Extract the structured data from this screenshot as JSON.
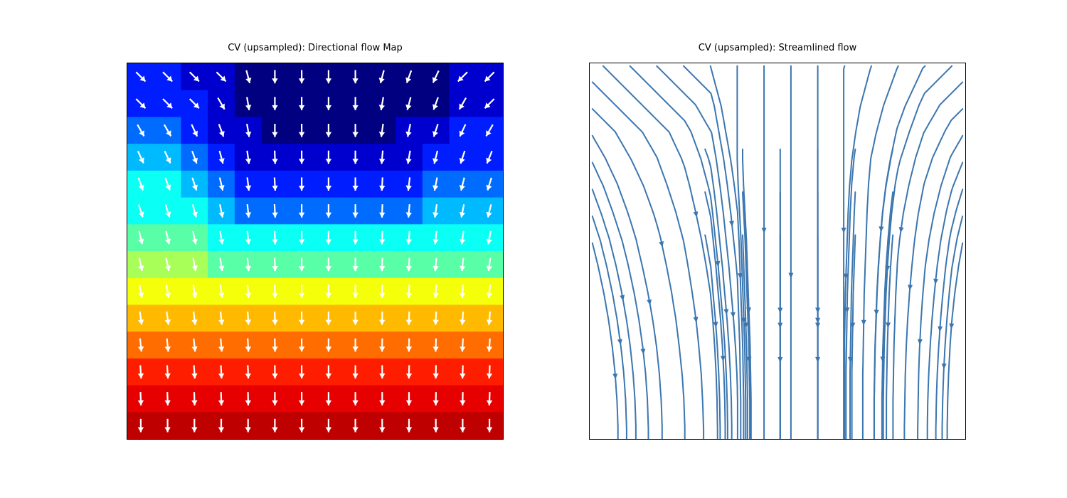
{
  "titles": {
    "left": "CV (upsampled): Directional flow Map",
    "right": "CV (upsampled): Streamlined flow"
  },
  "chart_data": [
    {
      "type": "heatmap",
      "name": "directional-flow",
      "title": "CV (upsampled): Directional flow Map",
      "grid": {
        "nx": 14,
        "ny": 14,
        "xlim": [
          0,
          14
        ],
        "ylim": [
          0,
          14
        ]
      },
      "colormap": "jet",
      "values_note": "Scalar field = row-index (0 top -> blue, 13 bottom -> red) with a dark-blue depression near columns 5-11 in rows 0-3. Arrows are unit vectors in white overlaid on each cell.",
      "scalar_rows": [
        [
          2,
          2,
          1,
          1,
          0,
          0,
          0,
          0,
          0,
          0,
          0,
          0,
          1,
          1
        ],
        [
          2,
          2,
          2,
          1,
          0,
          0,
          0,
          0,
          0,
          0,
          0,
          0,
          1,
          1
        ],
        [
          3,
          3,
          2,
          1,
          1,
          0,
          0,
          0,
          0,
          0,
          1,
          1,
          2,
          2
        ],
        [
          4,
          4,
          3,
          2,
          1,
          1,
          1,
          1,
          1,
          1,
          1,
          2,
          2,
          2
        ],
        [
          5,
          5,
          4,
          3,
          2,
          2,
          2,
          2,
          2,
          2,
          2,
          3,
          3,
          3
        ],
        [
          5,
          5,
          5,
          4,
          3,
          3,
          3,
          3,
          3,
          3,
          3,
          4,
          4,
          4
        ],
        [
          6,
          6,
          6,
          5,
          5,
          5,
          5,
          5,
          5,
          5,
          5,
          5,
          5,
          5
        ],
        [
          7,
          7,
          7,
          6,
          6,
          6,
          6,
          6,
          6,
          6,
          6,
          6,
          6,
          6
        ],
        [
          8,
          8,
          8,
          8,
          8,
          8,
          8,
          8,
          8,
          8,
          8,
          8,
          8,
          8
        ],
        [
          9,
          9,
          9,
          9,
          9,
          9,
          9,
          9,
          9,
          9,
          9,
          9,
          9,
          9
        ],
        [
          10,
          10,
          10,
          10,
          10,
          10,
          10,
          10,
          10,
          10,
          10,
          10,
          10,
          10
        ],
        [
          11,
          11,
          11,
          11,
          11,
          11,
          11,
          11,
          11,
          11,
          11,
          11,
          11,
          11
        ],
        [
          12,
          12,
          12,
          12,
          12,
          12,
          12,
          12,
          12,
          12,
          12,
          12,
          12,
          12
        ],
        [
          13,
          13,
          13,
          13,
          13,
          13,
          13,
          13,
          13,
          13,
          13,
          13,
          13,
          13
        ]
      ],
      "scalar_range": [
        0,
        13
      ],
      "flow_angles_deg_rows_note": "Arrow direction per cell in degrees, 270 = straight down, 225 = down-left, 315 = down-right. Flow converges toward center in upper rows, becomes uniformly downward in lower rows.",
      "flow_angles_deg_rows": [
        [
          315,
          315,
          315,
          315,
          285,
          270,
          270,
          270,
          270,
          255,
          250,
          245,
          225,
          225
        ],
        [
          315,
          315,
          315,
          300,
          280,
          270,
          270,
          270,
          270,
          260,
          255,
          250,
          240,
          225
        ],
        [
          300,
          300,
          295,
          290,
          280,
          270,
          270,
          270,
          270,
          262,
          258,
          252,
          245,
          240
        ],
        [
          295,
          295,
          290,
          285,
          278,
          272,
          270,
          270,
          270,
          265,
          260,
          256,
          252,
          248
        ],
        [
          290,
          290,
          288,
          283,
          277,
          273,
          270,
          270,
          270,
          267,
          263,
          259,
          256,
          253
        ],
        [
          288,
          287,
          285,
          282,
          276,
          273,
          270,
          270,
          270,
          268,
          265,
          262,
          259,
          256
        ],
        [
          284,
          283,
          282,
          280,
          276,
          272,
          270,
          270,
          270,
          268,
          266,
          264,
          262,
          260
        ],
        [
          282,
          282,
          281,
          279,
          275,
          272,
          270,
          270,
          270,
          268,
          267,
          265,
          264,
          262
        ],
        [
          280,
          280,
          279,
          278,
          275,
          272,
          270,
          270,
          270,
          269,
          268,
          266,
          265,
          264
        ],
        [
          278,
          278,
          277,
          276,
          274,
          272,
          270,
          270,
          270,
          269,
          268,
          267,
          266,
          265
        ],
        [
          276,
          276,
          276,
          275,
          273,
          271,
          270,
          270,
          270,
          269,
          269,
          268,
          267,
          266
        ],
        [
          274,
          274,
          274,
          273,
          272,
          271,
          270,
          270,
          270,
          270,
          269,
          269,
          268,
          267
        ],
        [
          272,
          272,
          272,
          272,
          271,
          270,
          270,
          270,
          270,
          270,
          270,
          269,
          269,
          268
        ],
        [
          270,
          270,
          270,
          270,
          270,
          270,
          270,
          270,
          270,
          270,
          270,
          270,
          270,
          270
        ]
      ],
      "arrow_color": "#ffffff",
      "arrow_length_cells": 0.55
    },
    {
      "type": "line",
      "name": "streamlined-flow",
      "title": "CV (upsampled): Streamlined flow",
      "xlim": [
        0,
        14
      ],
      "ylim": [
        0,
        14
      ],
      "line_color": "#3b76af",
      "line_width": 2,
      "description": "Streamlines integrated from the same vector field: lines fan in from top-left and top-right corners toward the upper-center region, then descend roughly vertically; lower-left streamlines curve rightward near the bottom; lower-right streamlines curve leftward near the bottom. Short arrowheads along each line point downward."
    }
  ]
}
